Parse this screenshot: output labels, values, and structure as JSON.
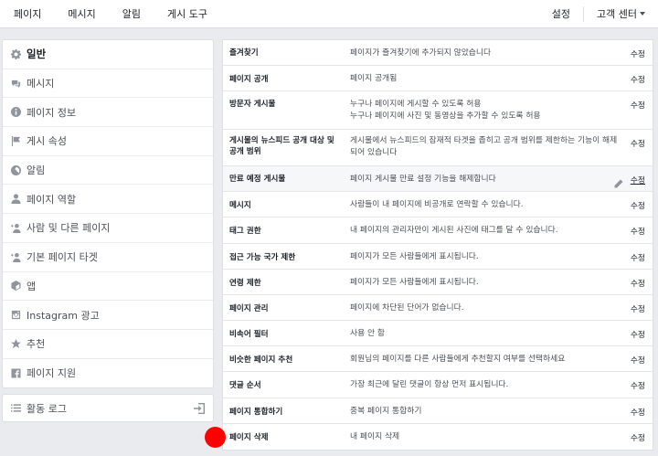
{
  "topbar": {
    "tabs": [
      "페이지",
      "메시지",
      "알림",
      "게시 도구"
    ],
    "settings_label": "설정",
    "help_label": "고객 센터"
  },
  "sidebar": {
    "items": [
      {
        "label": "일반",
        "icon": "gear-icon",
        "active": true
      },
      {
        "label": "메시지",
        "icon": "chat-icon"
      },
      {
        "label": "페이지 정보",
        "icon": "info-icon"
      },
      {
        "label": "게시 속성",
        "icon": "flag-icon"
      },
      {
        "label": "알림",
        "icon": "globe-icon"
      },
      {
        "label": "페이지 역할",
        "icon": "person-icon"
      },
      {
        "label": "사람 및 다른 페이지",
        "icon": "person-plus-icon"
      },
      {
        "label": "기본 페이지 타겟",
        "icon": "person-plus-icon"
      },
      {
        "label": "앱",
        "icon": "cube-icon"
      },
      {
        "label": "Instagram 광고",
        "icon": "instagram-icon"
      },
      {
        "label": "추천",
        "icon": "star-icon"
      },
      {
        "label": "페이지 지원",
        "icon": "facebook-icon"
      }
    ]
  },
  "activity_log": {
    "label": "활동 로그"
  },
  "settings": {
    "edit_label": "수정",
    "rows": [
      {
        "name": "즐겨찾기",
        "desc": [
          "페이지가 즐겨찾기에 추가되지 않았습니다"
        ]
      },
      {
        "name": "페이지 공개",
        "desc": [
          "페이지 공개됨"
        ]
      },
      {
        "name": "방문자 게시물",
        "desc": [
          "누구나 페이지에 게시할 수 있도록 허용",
          "누구나 페이지에 사진 및 동영상을 추가할 수 있도록 허용"
        ]
      },
      {
        "name": "게시물의 뉴스피드 공개 대상 및 공개 범위",
        "desc": [
          "게시물에서 뉴스피드의 잠재적 타겟을 좁히고 공개 범위를 제한하는 기능이 해제",
          "되어 있습니다"
        ]
      },
      {
        "name": "만료 예정 게시물",
        "desc": [
          "페이지 게시물 만료 설정 기능을 해제합니다"
        ],
        "highlighted": true
      },
      {
        "name": "메시지",
        "desc": [
          "사람들이 내 페이지에 비공개로 연락할 수 있습니다."
        ]
      },
      {
        "name": "태그 권한",
        "desc": [
          "내 페이지의 관리자만이 게시된 사진에 태그를 달 수 있습니다."
        ]
      },
      {
        "name": "접근 가능 국가 제한",
        "desc": [
          "페이지가 모든 사람들에게 표시됩니다."
        ]
      },
      {
        "name": "연령 제한",
        "desc": [
          "페이지가 모든 사람들에게 표시됩니다."
        ]
      },
      {
        "name": "페이지 관리",
        "desc": [
          "페이지에 차단된 단어가 없습니다."
        ]
      },
      {
        "name": "비속어 필터",
        "desc": [
          "사용 안 함"
        ]
      },
      {
        "name": "비슷한 페이지 추천",
        "desc": [
          "회원님의 페이지를 다른 사람들에게 추천할지 여부를 선택하세요"
        ]
      },
      {
        "name": "댓글 순서",
        "desc": [
          "가장 최근에 달린 댓글이 항상 먼저 표시됩니다."
        ]
      },
      {
        "name": "페이지 통합하기",
        "desc": [
          "중복 페이지 통합하기"
        ]
      },
      {
        "name": "페이지 삭제",
        "desc": [
          "내 페이지 삭제"
        ]
      }
    ]
  },
  "colors": {
    "page_bg": "#e9ebee",
    "marker": "#ff0000",
    "text": "#1d2129",
    "muted": "#4b4f56"
  }
}
